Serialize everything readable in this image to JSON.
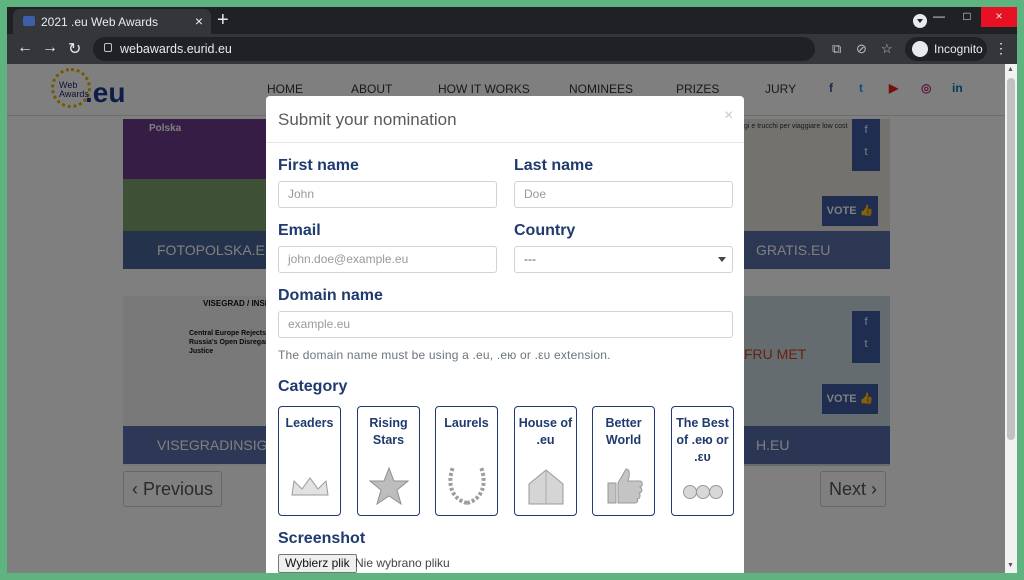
{
  "browser": {
    "tab_title": "2021 .eu Web Awards",
    "tab_close": "×",
    "new_tab": "+",
    "url": "webawards.eurid.eu",
    "incognito_label": "Incognito",
    "win_min": "—",
    "win_max": "□",
    "win_close": "×",
    "back": "←",
    "forward": "→",
    "reload": "↻",
    "menu": "⋮"
  },
  "site": {
    "logo_text_line1": "Web",
    "logo_text_line2": "Awards",
    "logo_eu": ".eu",
    "nav": [
      "HOME",
      "ABOUT",
      "HOW IT WORKS",
      "NOMINEES",
      "PRIZES",
      "JURY"
    ],
    "social": [
      "f",
      "t",
      "▶",
      "◎",
      "in"
    ]
  },
  "nominees": {
    "cards": [
      {
        "label": "FOTOPOLSKA.EU",
        "header": "Polska"
      },
      {
        "label": "GRATIS.EU",
        "header": "gi e trucchi per viaggiare low cost"
      },
      {
        "label": "VISEGRADINSIGHT.EU",
        "header": "VISEGRAD / INSIGHT",
        "headline": "Central Europe Rejects Russia's Open Disregard for Justice"
      },
      {
        "label": "H.EU",
        "header": "FRU MET"
      }
    ],
    "vote_label": "VOTE 👍",
    "prev_label": "‹ Previous",
    "next_label": "Next ›"
  },
  "modal": {
    "title": "Submit your nomination",
    "close": "×",
    "first_name_label": "First name",
    "first_name_placeholder": "John",
    "last_name_label": "Last name",
    "last_name_placeholder": "Doe",
    "email_label": "Email",
    "email_placeholder": "john.doe@example.eu",
    "country_label": "Country",
    "country_value": "---",
    "domain_label": "Domain name",
    "domain_placeholder": "example.eu",
    "domain_help": "The domain name must be using a .eu, .ею or .ευ extension.",
    "category_label": "Category",
    "categories": [
      {
        "name": "Leaders",
        "icon": "crown-icon"
      },
      {
        "name": "Rising Stars",
        "icon": "star-icon"
      },
      {
        "name": "Laurels",
        "icon": "laurel-wreath-icon"
      },
      {
        "name": "House of .eu",
        "icon": "house-icon"
      },
      {
        "name": "Better World",
        "icon": "thumbs-up-icon"
      },
      {
        "name": "The Best of .ею or .ευ",
        "icon": "three-globes-icon"
      }
    ],
    "screenshot_label": "Screenshot",
    "file_button": "Wybierz plik",
    "file_status": "Nie wybrano pliku"
  }
}
